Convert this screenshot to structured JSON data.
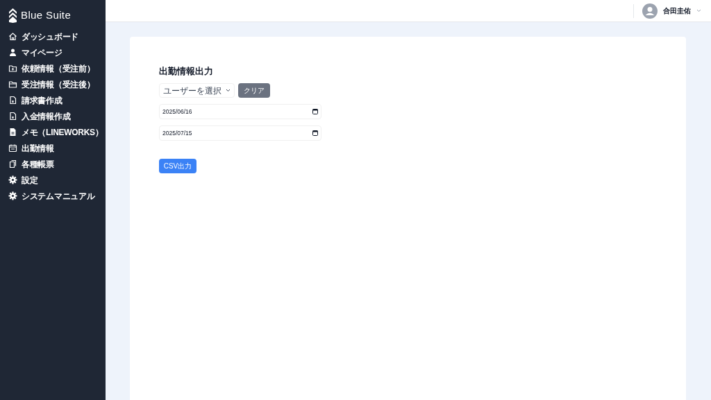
{
  "sidebar": {
    "logo": "Blue Suite",
    "items": [
      {
        "label": "ダッシュボード"
      },
      {
        "label": "マイページ"
      },
      {
        "label": "依頼情報（受注前）"
      },
      {
        "label": "受注情報（受注後）"
      },
      {
        "label": "請求書作成"
      },
      {
        "label": "入金情報作成"
      },
      {
        "label": "メモ（LINEWORKS）"
      },
      {
        "label": "出勤情報"
      },
      {
        "label": "各種帳票"
      },
      {
        "label": "設定"
      },
      {
        "label": "システムマニュアル"
      }
    ]
  },
  "header": {
    "user_name": "合田圭佑"
  },
  "form": {
    "title": "出勤情報出力",
    "user_select": {
      "value": "ユーザーを選択"
    },
    "clear_button": "クリア",
    "dates": [
      {
        "value": "2025/06/16"
      },
      {
        "value": "2025/07/15"
      }
    ],
    "export_button": "CSV出力"
  }
}
